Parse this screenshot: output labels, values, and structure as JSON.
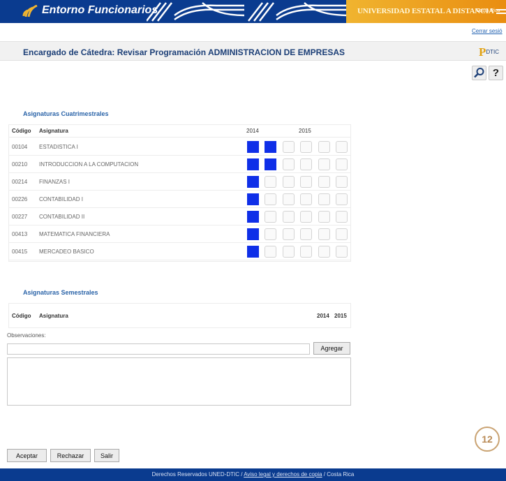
{
  "header": {
    "brand": "Entorno Funcionarios",
    "university": "UNIVERSIDAD ESTATAL A DISTANCIA",
    "country": "Costa Rica",
    "brand_color": "#0a3b8f",
    "accent_color": "#f0b430"
  },
  "session": {
    "logout": "Cerrar sesió"
  },
  "title": {
    "text": "Encargado de Cátedra: Revisar Programación ADMINISTRACION DE EMPRESAS",
    "logo_initial": "P",
    "logo_text": "DTIC"
  },
  "tools": {
    "search_icon": "magnifier-icon",
    "help_label": "?"
  },
  "cuatrimestrales": {
    "section_title": "Asignaturas Cuatrimestrales",
    "col_code": "Código",
    "col_name": "Asignatura",
    "year1": "2014",
    "year2": "2015",
    "rows": [
      {
        "code": "00104",
        "name": "ESTADISTICA I",
        "filled": 2
      },
      {
        "code": "00210",
        "name": "INTRODUCCION A LA COMPUTACION",
        "filled": 2
      },
      {
        "code": "00214",
        "name": "FINANZAS I",
        "filled": 1
      },
      {
        "code": "00226",
        "name": "CONTABILIDAD I",
        "filled": 1
      },
      {
        "code": "00227",
        "name": "CONTABILIDAD II",
        "filled": 1
      },
      {
        "code": "00413",
        "name": "MATEMATICA FINANCIERA",
        "filled": 1
      },
      {
        "code": "00415",
        "name": "MERCADEO BASICO",
        "filled": 1
      }
    ],
    "selected_color": "#0f2fe8"
  },
  "semestrales": {
    "section_title": "Asignaturas Semestrales",
    "col_code": "Código",
    "col_name": "Asignatura",
    "year1": "2014",
    "year2": "2015"
  },
  "observaciones": {
    "label": "Observaciones:",
    "value": "",
    "add_button": "Agregar"
  },
  "actions": {
    "accept": "Aceptar",
    "reject": "Rechazar",
    "exit": "Salir"
  },
  "page_number": "12",
  "footer": {
    "prefix": "Derechos Reservados UNED-DTIC / ",
    "legal_link": "Aviso legal y derechos de copia",
    "suffix": " / Costa Rica"
  }
}
